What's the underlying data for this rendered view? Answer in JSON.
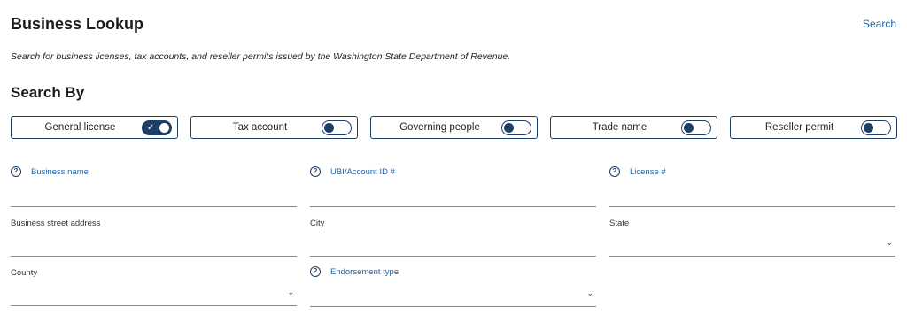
{
  "header": {
    "title": "Business Lookup",
    "search_link": "Search",
    "description": "Search for business licenses, tax accounts, and reseller permits issued by the Washington State Department of Revenue."
  },
  "search_by": {
    "heading": "Search By",
    "toggles": [
      {
        "label": "General license",
        "on": true
      },
      {
        "label": "Tax account",
        "on": false
      },
      {
        "label": "Governing people",
        "on": false
      },
      {
        "label": "Trade name",
        "on": false
      },
      {
        "label": "Reseller permit",
        "on": false
      }
    ]
  },
  "fields": {
    "business_name": "Business name",
    "ubi": "UBI/Account ID #",
    "license": "License #",
    "street": "Business street address",
    "city": "City",
    "state": "State",
    "county": "County",
    "endorsement": "Endorsement type"
  },
  "colors": {
    "accent": "#1d3f66",
    "link": "#1f63a6"
  }
}
